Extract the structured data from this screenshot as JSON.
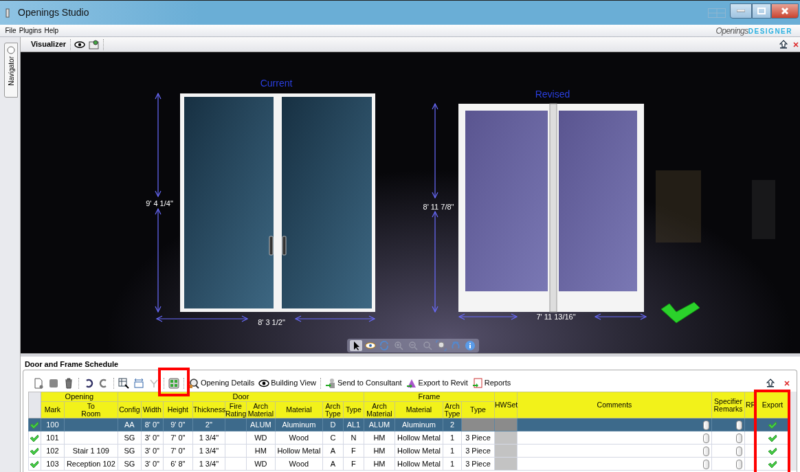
{
  "window": {
    "title": "Openings Studio"
  },
  "menu": [
    {
      "label": "File"
    },
    {
      "label": "Plugins"
    },
    {
      "label": "Help"
    }
  ],
  "logo": {
    "first": "Openings",
    "second": "DESIGNER"
  },
  "navigator": {
    "label": "Navigator"
  },
  "visualizer": {
    "title": "Visualizer",
    "current": {
      "label": "Current",
      "height": "9' 4 1/4\"",
      "width": "8' 3 1/2\""
    },
    "revised": {
      "label": "Revised",
      "height": "8' 11 7/8\"",
      "width": "7' 11 13/16\""
    }
  },
  "schedule": {
    "title": "Door and Frame Schedule",
    "toolbar": {
      "grid_button_highlighted": true,
      "buttons": [
        {
          "kind": "details",
          "label": "Opening Details"
        },
        {
          "kind": "view",
          "label": "Building View"
        },
        {
          "kind": "send",
          "label": "Send to Consultant"
        },
        {
          "kind": "revit",
          "label": "Export to Revit"
        },
        {
          "kind": "reports",
          "label": "Reports"
        }
      ]
    },
    "table": {
      "column_groups": [
        {
          "label": "Opening",
          "columns": [
            {
              "label": "Mark"
            },
            {
              "label": "To\nRoom"
            }
          ]
        },
        {
          "label": "Door",
          "columns": [
            {
              "label": "Config"
            },
            {
              "label": "Width"
            },
            {
              "label": "Height"
            },
            {
              "label": "Thickness"
            },
            {
              "label": "Fire\nRating"
            },
            {
              "label": "Arch\nMaterial"
            },
            {
              "label": "Material"
            },
            {
              "label": "Arch\nType"
            },
            {
              "label": "Type"
            }
          ]
        },
        {
          "label": "Frame",
          "columns": [
            {
              "label": "Arch\nMaterial"
            },
            {
              "label": "Material"
            },
            {
              "label": "Arch\nType"
            },
            {
              "label": "Type"
            }
          ]
        }
      ],
      "other_columns": [
        {
          "label": "HWSet"
        },
        {
          "label": "Comments"
        },
        {
          "label": "Specifier\nRemarks"
        },
        {
          "label": "RF"
        },
        {
          "label": "Export",
          "highlighted": true
        }
      ],
      "rows": [
        {
          "selected": true,
          "valid": true,
          "export": true,
          "cells": [
            "100",
            "",
            "AA",
            "8' 0\"",
            "9' 0\"",
            "2\"",
            "",
            "ALUM",
            "Aluminum",
            "D",
            "AL1",
            "ALUM",
            "Aluminum",
            "2",
            "",
            "",
            "",
            "",
            ""
          ]
        },
        {
          "selected": false,
          "valid": true,
          "export": true,
          "cells": [
            "101",
            "",
            "SG",
            "3' 0\"",
            "7' 0\"",
            "1 3/4\"",
            "",
            "WD",
            "Wood",
            "C",
            "N",
            "HM",
            "Hollow Metal",
            "1",
            "3 Piece",
            "",
            "",
            "",
            ""
          ]
        },
        {
          "selected": false,
          "valid": true,
          "export": true,
          "cells": [
            "102",
            "Stair 1 109",
            "SG",
            "3' 0\"",
            "7' 0\"",
            "1 3/4\"",
            "",
            "HM",
            "Hollow Metal",
            "A",
            "F",
            "HM",
            "Hollow Metal",
            "1",
            "3 Piece",
            "",
            "",
            "",
            ""
          ]
        },
        {
          "selected": false,
          "valid": true,
          "export": true,
          "cells": [
            "103",
            "Reception 102",
            "SG",
            "3' 0\"",
            "6' 8\"",
            "1 3/4\"",
            "",
            "WD",
            "Wood",
            "A",
            "F",
            "HM",
            "Hollow Metal",
            "1",
            "3 Piece",
            "",
            "",
            "",
            ""
          ]
        }
      ]
    }
  }
}
